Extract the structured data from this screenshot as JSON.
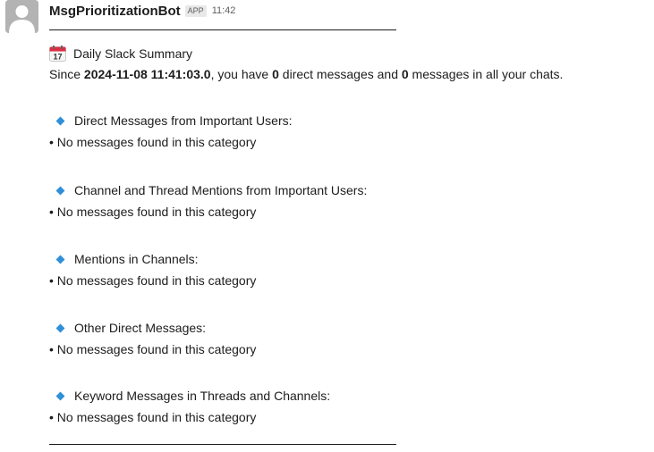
{
  "bot": {
    "name": "MsgPrioritizationBot",
    "badge": "APP",
    "time": "11:42"
  },
  "summary": {
    "title": "Daily Slack Summary",
    "calendar_day": "17",
    "since_prefix": "Since ",
    "since_date": "2024-11-08 11:41:03.0",
    "mid1": ", you have ",
    "dm_count": "0",
    "mid2": " direct messages and ",
    "msg_count": "0",
    "suffix": " messages in all your chats."
  },
  "categories": [
    {
      "heading": "Direct Messages from Important Users:",
      "empty_text": "• No messages found in this category"
    },
    {
      "heading": "Channel and Thread Mentions from Important Users:",
      "empty_text": "• No messages found in this category"
    },
    {
      "heading": "Mentions in Channels:",
      "empty_text": "• No messages found in this category"
    },
    {
      "heading": "Other Direct Messages:",
      "empty_text": "• No messages found in this category"
    },
    {
      "heading": "Keyword Messages in Threads and Channels:",
      "empty_text": "• No messages found in this category"
    }
  ],
  "colors": {
    "bullet_diamond": "#2f8fd8",
    "calendar_red": "#dd2e44"
  }
}
